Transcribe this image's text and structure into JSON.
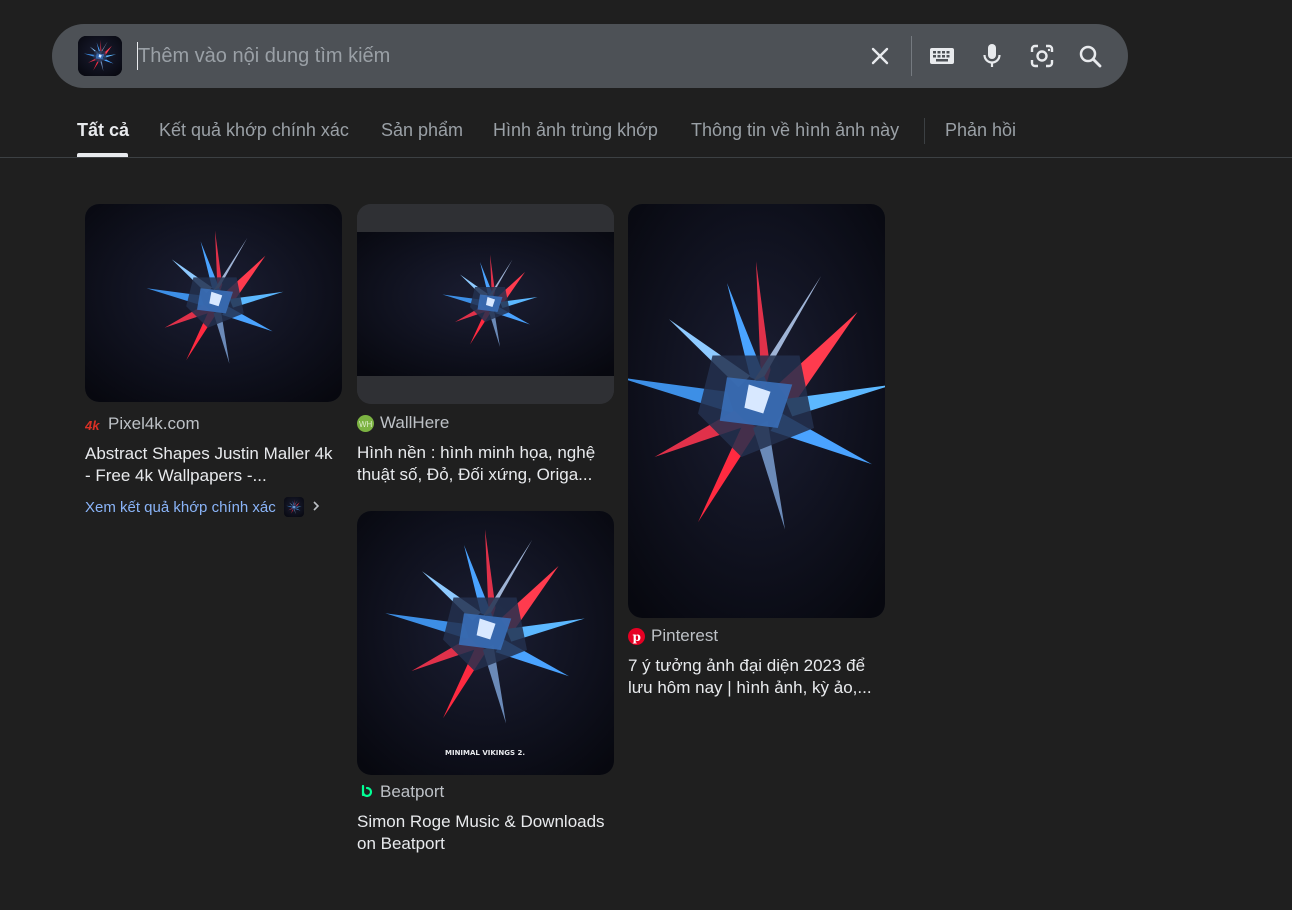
{
  "search": {
    "placeholder": "Thêm vào nội dung tìm kiếm",
    "thumb_icon": "query-image-thumbnail",
    "icons": [
      "close-icon",
      "keyboard-icon",
      "microphone-icon",
      "lens-icon",
      "search-icon"
    ]
  },
  "tabs": [
    {
      "label": "Tất cả",
      "active": true
    },
    {
      "label": "Kết quả khớp chính xác"
    },
    {
      "label": "Sản phẩm"
    },
    {
      "label": "Hình ảnh trùng khớp"
    },
    {
      "label": "Thông tin về hình ảnh này"
    },
    {
      "label": "Phản hồi"
    }
  ],
  "results": [
    {
      "source": "Pixel4k.com",
      "title": "Abstract Shapes Justin Maller 4k - Free 4k Wallpapers -...",
      "favicon": "pixel4k-logo",
      "favicon_color": "#d93025"
    },
    {
      "source": "WallHere",
      "title": "Hình nền : hình minh họa, nghệ thuật số, Đỏ, Đối xứng, Origa...",
      "favicon": "wallhere-logo",
      "favicon_color": "#7cb342"
    },
    {
      "source": "Beatport",
      "title": "Simon Roge Music & Downloads on Beatport",
      "favicon": "beatport-logo",
      "favicon_color": "#01ff95",
      "image_caption": "MINIMAL VIKINGS 2."
    },
    {
      "source": "Pinterest",
      "title": "7 ý tưởng ảnh đại diện 2023 để lưu hôm nay | hình ảnh, kỳ ảo,...",
      "favicon": "pinterest-logo",
      "favicon_color": "#e60023"
    }
  ],
  "exact_match_link": "Xem kết quả khớp chính xác",
  "colors": {
    "background": "#1f1f1f",
    "search_bar": "#4d5156",
    "link": "#8ab4f8",
    "text": "#e8eaed",
    "muted": "#9aa0a6"
  }
}
